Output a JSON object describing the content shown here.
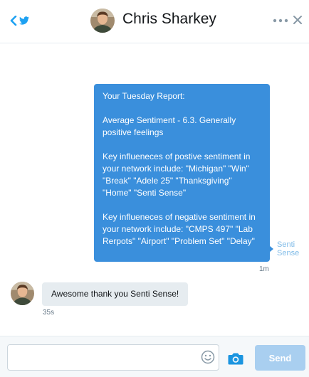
{
  "header": {
    "contact_name": "Chris Sharkey",
    "icons": [
      "chevron-left-icon",
      "twitter-bird-icon",
      "more-dots-icon",
      "close-icon"
    ]
  },
  "conversation": {
    "outgoing": {
      "paragraphs": [
        "Your Tuesday Report:",
        "Average Sentiment - 6.3. Generally positive feelings",
        "Key influeneces of postive sentiment in your network include: \"Michigan\" \"Win\" \"Break\" \"Adele 25\" \"Thanksgiving\" \"Home\" \"Senti Sense\"",
        "Key influeneces of negative sentiment in your network include: \"CMPS 497\" \"Lab Rerpots\" \"Airport\" \"Problem Set\" \"Delay\""
      ],
      "sender_logo_line1": "Senti",
      "sender_logo_line2": "Sense",
      "time": "1m"
    },
    "incoming": {
      "text": "Awesome thank you Senti Sense!",
      "time": "35s"
    }
  },
  "composer": {
    "input_value": "",
    "input_placeholder": "",
    "send_label": "Send",
    "icons": [
      "emoji-icon",
      "camera-icon"
    ]
  },
  "colors": {
    "accent": "#1da1f2",
    "outgoing_bubble": "#3a8fdc",
    "incoming_bubble": "#e6ecf0",
    "send_disabled": "#a9cff0"
  }
}
